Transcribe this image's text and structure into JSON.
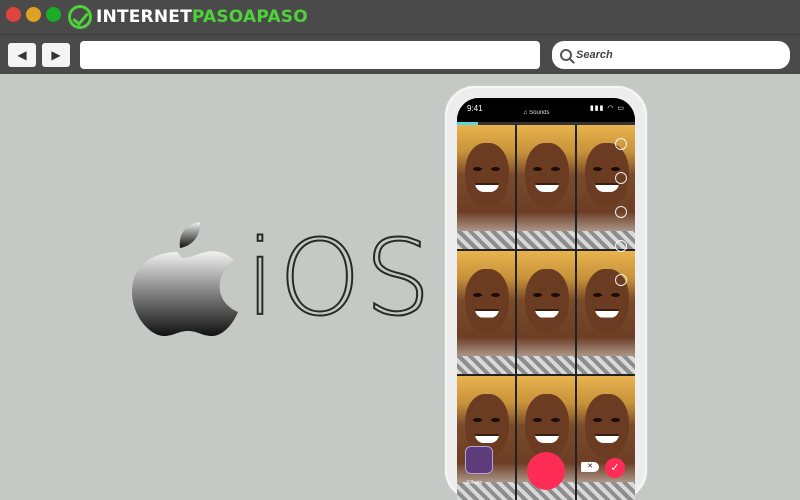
{
  "brand": {
    "name_part1": "INTERNET",
    "name_part2": "PASOAPASO",
    "accent": "#4fd13a"
  },
  "window": {
    "controls": [
      "close",
      "minimize",
      "maximize"
    ]
  },
  "toolbar": {
    "back_glyph": "◀",
    "forward_glyph": "▶",
    "url_value": "",
    "search_placeholder": "Search"
  },
  "content": {
    "platform_label": "iOS",
    "icons": [
      "apple-logo-icon"
    ]
  },
  "phone": {
    "status_time": "9:41",
    "status_icons": "▮▮▮ ◠ ▭",
    "sounds_label": "♫ Sounds",
    "recording_progress": 0.12,
    "effects_label": "Effects",
    "record_color": "#ff2d55",
    "delete_glyph": "✕",
    "confirm_glyph": "✓"
  }
}
